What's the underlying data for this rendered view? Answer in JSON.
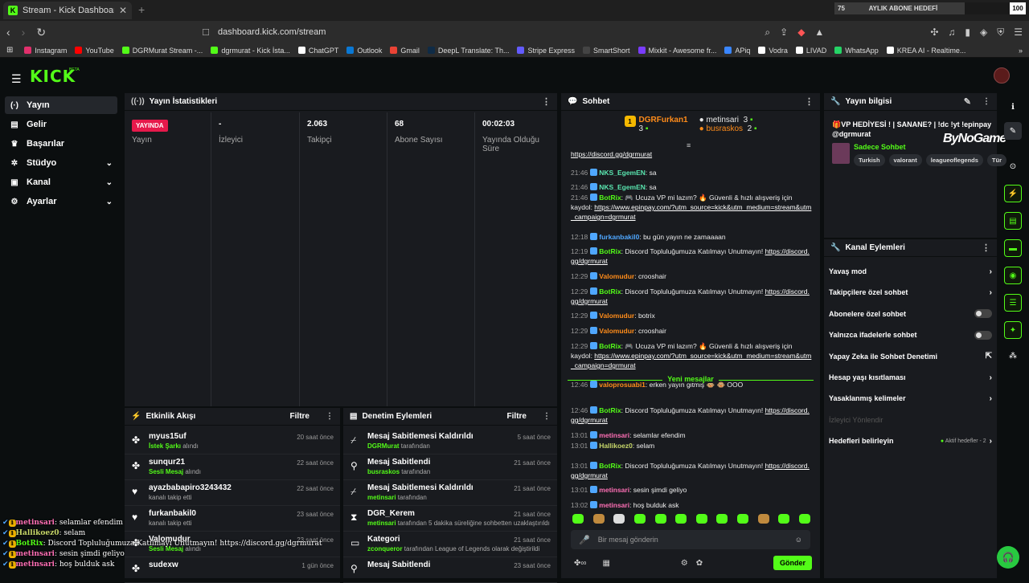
{
  "browser": {
    "tab_title": "Stream - Kick Dashboard",
    "new_tab": "+",
    "url": "dashboard.kick.com/stream",
    "goal": {
      "start": "75",
      "label": "AYLIK ABONE HEDEFİ",
      "end": "100",
      "progress_percent": 75
    },
    "bookmarks": [
      {
        "label": "Instagram",
        "color": "#e1306c"
      },
      {
        "label": "YouTube",
        "color": "#ff0000"
      },
      {
        "label": "DGRMurat Stream -...",
        "color": "#53fc18"
      },
      {
        "label": "dgrmurat - Kick İsta...",
        "color": "#53fc18"
      },
      {
        "label": "ChatGPT",
        "color": "#ffffff"
      },
      {
        "label": "Outlook",
        "color": "#0a78d4"
      },
      {
        "label": "Gmail",
        "color": "#ea4335"
      },
      {
        "label": "DeepL Translate: Th...",
        "color": "#0f2b46"
      },
      {
        "label": "Stripe Express",
        "color": "#635bff"
      },
      {
        "label": "SmartShort",
        "color": "#444444"
      },
      {
        "label": "Mixkit - Awesome fr...",
        "color": "#7a3cff"
      },
      {
        "label": "APiq",
        "color": "#3a86ff"
      },
      {
        "label": "Vodra",
        "color": "#ffffff"
      },
      {
        "label": "LIVAD",
        "color": "#ffffff"
      },
      {
        "label": "WhatsApp",
        "color": "#25d366"
      },
      {
        "label": "KREA AI - Realtime...",
        "color": "#ffffff"
      }
    ]
  },
  "header": {
    "logo": "KICK",
    "beta": "BETA"
  },
  "sidebar": {
    "items": [
      {
        "label": "Yayın",
        "icon": "broadcast-icon",
        "glyph": "(·)",
        "active": true,
        "chevron": false
      },
      {
        "label": "Gelir",
        "icon": "wallet-icon",
        "glyph": "▤",
        "active": false,
        "chevron": false
      },
      {
        "label": "Başarılar",
        "icon": "trophy-icon",
        "glyph": "♛",
        "active": false,
        "chevron": false
      },
      {
        "label": "Stüdyo",
        "icon": "studio-icon",
        "glyph": "✲",
        "active": false,
        "chevron": true
      },
      {
        "label": "Kanal",
        "icon": "channel-icon",
        "glyph": "▣",
        "active": false,
        "chevron": true
      },
      {
        "label": "Ayarlar",
        "icon": "settings-icon",
        "glyph": "⚙",
        "active": false,
        "chevron": true
      }
    ]
  },
  "stats": {
    "title": "Yayın İstatistikleri",
    "cells": [
      {
        "value": "YAYINDA",
        "label": "Yayın"
      },
      {
        "value": "-",
        "label": "İzleyici"
      },
      {
        "value": "2.063",
        "label": "Takipçi"
      },
      {
        "value": "68",
        "label": "Abone Sayısı"
      },
      {
        "value": "00:02:03",
        "label": "Yayında Olduğu Süre"
      }
    ]
  },
  "activity": {
    "title": "Etkinlik Akışı",
    "filter": "Filtre",
    "rows": [
      {
        "name": "myus15uf",
        "sub_b": "İstek Şarkı",
        "sub": " alındı",
        "time": "20 saat önce",
        "glyph": "✤"
      },
      {
        "name": "sunqur21",
        "sub_b": "Sesli Mesaj",
        "sub": " alındı",
        "time": "22 saat önce",
        "glyph": "✤"
      },
      {
        "name": "ayazbabapiro3243432",
        "sub_b": "",
        "sub": "kanalı takip etti",
        "time": "22 saat önce",
        "glyph": "♥"
      },
      {
        "name": "furkanbakil0",
        "sub_b": "",
        "sub": "kanalı takip etti",
        "time": "23 saat önce",
        "glyph": "♥"
      },
      {
        "name": "Valomudur",
        "sub_b": "Sesli Mesaj",
        "sub": " alındı",
        "time": "23 saat önce",
        "glyph": "✤"
      },
      {
        "name": "sudexw",
        "sub_b": "",
        "sub": "",
        "time": "1 gün önce",
        "glyph": "✤"
      }
    ]
  },
  "moderation": {
    "title": "Denetim Eylemleri",
    "filter": "Filtre",
    "rows": [
      {
        "name": "Mesaj Sabitlemesi Kaldırıldı",
        "sub_b": "DGRMurat",
        "sub": " tarafından",
        "time": "5 saat önce",
        "glyph": "⌿"
      },
      {
        "name": "Mesaj Sabitlendi",
        "sub_b": "busraskos",
        "sub": " tarafından",
        "time": "21 saat önce",
        "glyph": "⚲"
      },
      {
        "name": "Mesaj Sabitlemesi Kaldırıldı",
        "sub_b": "metinsari",
        "sub": " tarafından",
        "time": "21 saat önce",
        "glyph": "⌿"
      },
      {
        "name": "DGR_Kerem",
        "sub_b": "metinsari",
        "sub": " tarafından 5 dakika süreliğine sohbetten uzaklaştırıldı",
        "time": "21 saat önce",
        "glyph": "⧗"
      },
      {
        "name": "Kategori",
        "sub_b": "zconqueror",
        "sub": " tarafından League of Legends olarak değiştirildi",
        "time": "21 saat önce",
        "glyph": "▭"
      },
      {
        "name": "Mesaj Sabitlendi",
        "sub_b": "",
        "sub": "",
        "time": "23 saat önce",
        "glyph": "⚲"
      }
    ]
  },
  "chat": {
    "title": "Sohbet",
    "pinned": [
      {
        "name": "DGRFurkan1",
        "count": "3"
      },
      {
        "name": "metinsari",
        "count": "3"
      },
      {
        "name": "busraskos",
        "count": "2"
      }
    ],
    "new_messages": "Yeni mesajlar",
    "messages": [
      {
        "time": "",
        "user": "",
        "color": "",
        "text": "",
        "link": "https://discord.gg/dgrmurat"
      },
      {
        "time": "21:46",
        "user": "NKS_EgemEN",
        "color": "teal",
        "text": ": sa",
        "link": ""
      },
      {
        "time": "21:46",
        "user": "NKS_EgemEN",
        "color": "teal",
        "text": ": sa",
        "link": ""
      },
      {
        "time": "21:46",
        "user": "BotRix",
        "color": "green",
        "text": ": 🎮 Ucuza VP mi lazım? 🔥 Güvenli & hızlı alışveriş için kaydol: ",
        "link": "https://www.epinpay.com/?utm_source=kick&utm_medium=stream&utm_campaign=dgrmurat"
      },
      {
        "time": "12:18",
        "user": "furkanbakil0",
        "color": "blue",
        "text": ": bu gün yayın ne zamaaaan",
        "link": ""
      },
      {
        "time": "12:19",
        "user": "BotRix",
        "color": "green",
        "text": ": Discord Topluluğumuza Katılmayı Unutmayın! ",
        "link": "https://discord.gg/dgrmurat"
      },
      {
        "time": "12:29",
        "user": "Valomudur",
        "color": "orange",
        "text": ": crooshair",
        "link": ""
      },
      {
        "time": "12:29",
        "user": "BotRix",
        "color": "green",
        "text": ": Discord Topluluğumuza Katılmayı Unutmayın! ",
        "link": "https://discord.gg/dgrmurat"
      },
      {
        "time": "12:29",
        "user": "Valomudur",
        "color": "orange",
        "text": ": botrix",
        "link": ""
      },
      {
        "time": "12:29",
        "user": "Valomudur",
        "color": "orange",
        "text": ": crooshair",
        "link": ""
      },
      {
        "time": "12:29",
        "user": "BotRix",
        "color": "green",
        "text": ": 🎮 Ucuza VP mi lazım? 🔥 Güvenli & hızlı alışveriş için kaydol: ",
        "link": "https://www.epinpay.com/?utm_source=kick&utm_medium=stream&utm_campaign=dgrmurat"
      },
      {
        "time": "12:46",
        "user": "valoprosuabi1",
        "color": "orange",
        "text": ": erken yayın gitmiş 🐵 🐵 OOO",
        "link": ""
      },
      {
        "time": "12:46",
        "user": "BotRix",
        "color": "green",
        "text": ": Discord Topluluğumuza Katılmayı Unutmayın! ",
        "link": "https://discord.gg/dgrmurat"
      },
      {
        "time": "13:01",
        "user": "metinsari",
        "color": "pink",
        "text": ": selamlar efendim",
        "link": ""
      },
      {
        "time": "13:01",
        "user": "Hallikoez0",
        "color": "olive",
        "text": ": selam",
        "link": ""
      },
      {
        "time": "13:01",
        "user": "BotRix",
        "color": "green",
        "text": ": Discord Topluluğumuza Katılmayı Unutmayın! ",
        "link": "https://discord.gg/dgrmurat"
      },
      {
        "time": "13:01",
        "user": "metinsari",
        "color": "pink",
        "text": ": sesin şimdi geliyo",
        "link": ""
      },
      {
        "time": "13:02",
        "user": "metinsari",
        "color": "pink",
        "text": ": hoş bulduk ask",
        "link": ""
      }
    ],
    "input_placeholder": "Bir mesaj gönderin",
    "send": "Gönder"
  },
  "info": {
    "title": "Yayın bilgisi",
    "stream_title": "🎁VP HEDİYESİ ! | SANANE? | !dc !yt !epinpay @dgrmurat",
    "category": "Sadece Sohbet",
    "tags": [
      "Turkish",
      "valorant",
      "leagueoflegends",
      "Tür"
    ],
    "overlay_brand": "ByNoGame"
  },
  "actions": {
    "title": "Kanal Eylemleri",
    "rows": [
      {
        "label": "Yavaş mod",
        "type": "chevron"
      },
      {
        "label": "Takipçilere özel sohbet",
        "type": "chevron"
      },
      {
        "label": "Abonelere özel sohbet",
        "type": "toggle"
      },
      {
        "label": "Yalnızca ifadelerle sohbet",
        "type": "toggle"
      },
      {
        "label": "Yapay Zeka ile Sohbet Denetimi",
        "type": "external"
      },
      {
        "label": "Hesap yaşı kısıtlaması",
        "type": "chevron"
      },
      {
        "label": "Yasaklanmış kelimeler",
        "type": "chevron"
      },
      {
        "label": "İzleyici Yönlendir",
        "type": "disabled"
      },
      {
        "label": "Hedefleri belirleyin",
        "type": "chevron",
        "note": "Aktif hedefler - 2"
      }
    ]
  },
  "overlay_chat": [
    {
      "user": "metinsari",
      "color": "#ff6fb5",
      "text": ": selamlar efendim"
    },
    {
      "user": "Hallikoez0",
      "color": "#c8d86a",
      "text": ": selam"
    },
    {
      "user": "BotRix",
      "color": "#53fc18",
      "text": ": Discord Topluluğumuza Katılmayı Unutmayın! https://discord.gg/dgrmurat"
    },
    {
      "user": "metinsari",
      "color": "#ff6fb5",
      "text": ": sesin şimdi geliyo"
    },
    {
      "user": "metinsari",
      "color": "#ff6fb5",
      "text": ": hoş bulduk ask"
    }
  ]
}
